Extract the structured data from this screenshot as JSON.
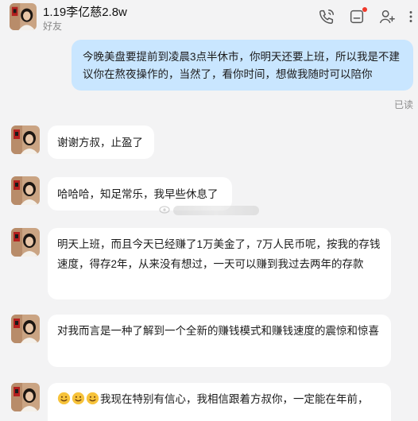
{
  "header": {
    "title": "1.19李亿慈2.8w",
    "subtitle": "好友",
    "icons": [
      "phone-call-icon",
      "notes-icon",
      "add-friend-icon",
      "more-icon"
    ]
  },
  "messages": {
    "sent_text": "今晚美盘要提前到凌晨3点半休市，你明天还要上班，所以我是不建议你在熬夜操作的，当然了，看你时间，想做我随时可以陪你",
    "read_status": "已读",
    "m1": "谢谢方叔，止盈了",
    "m2": "哈哈哈，知足常乐，我早些休息了",
    "m3": "明天上班，而且今天已经赚了1万美金了，7万人民币呢，按我的存钱速度，得存2年，从来没有想过，一天可以赚到我过去两年的存款",
    "m4": "对我而言是一种了解到一个全新的赚钱模式和赚钱速度的震惊和惊喜",
    "m5": "我现在特别有信心，我相信跟着方叔你，一定能在年前，"
  },
  "colors": {
    "background": "#f3f3f4",
    "sent_bubble": "#c9e6ff",
    "received_bubble": "#ffffff",
    "notification_dot": "#f0392b"
  }
}
